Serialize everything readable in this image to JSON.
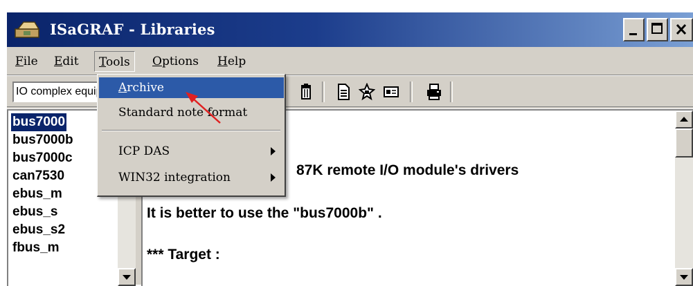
{
  "window": {
    "title": "ISaGRAF - Libraries"
  },
  "menubar": {
    "items": [
      {
        "label_pre": "",
        "label_u": "F",
        "label_post": "ile"
      },
      {
        "label_pre": "",
        "label_u": "E",
        "label_post": "dit"
      },
      {
        "label_pre": "",
        "label_u": "T",
        "label_post": "ools"
      },
      {
        "label_pre": "",
        "label_u": "O",
        "label_post": "ptions"
      },
      {
        "label_pre": "",
        "label_u": "H",
        "label_post": "elp"
      }
    ]
  },
  "toolbar": {
    "library_combo_value": "IO complex equipments",
    "icons": [
      "delete-icon",
      "note-icon",
      "compile-icon",
      "properties-icon",
      "print-icon"
    ]
  },
  "tools_menu": {
    "items": [
      {
        "label_u": "A",
        "label_post": "rchive",
        "highlighted": true,
        "submenu": false
      },
      {
        "label": "Standard note format",
        "highlighted": false,
        "submenu": false
      },
      {
        "label": "ICP DAS",
        "highlighted": false,
        "submenu": true
      },
      {
        "label": "WIN32 integration",
        "highlighted": false,
        "submenu": true
      }
    ]
  },
  "library_list": {
    "items": [
      {
        "label": "bus7000",
        "selected": true
      },
      {
        "label": "bus7000b",
        "selected": false
      },
      {
        "label": "bus7000c",
        "selected": false
      },
      {
        "label": "can7530",
        "selected": false
      },
      {
        "label": "ebus_m",
        "selected": false
      },
      {
        "label": "ebus_s",
        "selected": false
      },
      {
        "label": "ebus_s2",
        "selected": false
      },
      {
        "label": "fbus_m",
        "selected": false
      }
    ]
  },
  "note": {
    "lines": [
      "87K remote I/O module's drivers",
      "It is better to use the \"bus7000b\" .",
      "*** Target :"
    ]
  },
  "colors": {
    "title_bar": "#0a246a",
    "menu_highlight": "#2c5aa8",
    "selection": "#0a246a",
    "annotation_arrow": "#e02020"
  }
}
